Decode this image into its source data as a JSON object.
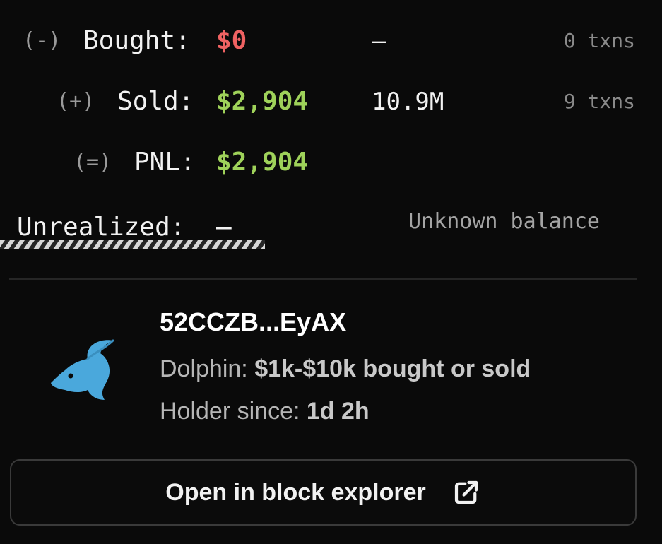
{
  "rows": {
    "bought": {
      "op": "(-)",
      "label": "Bought:",
      "value": "$0",
      "amount": "–",
      "txns": "0 txns"
    },
    "sold": {
      "op": "(+)",
      "label": "Sold:",
      "value": "$2,904",
      "amount": "10.9M",
      "txns": "9 txns"
    },
    "pnl": {
      "op": "(=)",
      "label": "PNL:",
      "value": "$2,904"
    },
    "unrealized": {
      "label": "Unrealized:",
      "value": "–",
      "balance_note": "Unknown balance"
    }
  },
  "holder": {
    "icon": "dolphin-icon",
    "address": "52CCZB...EyAX",
    "tier_label": "Dolphin:",
    "tier_value": "$1k-$10k bought or sold",
    "since_label": "Holder since:",
    "since_value": "1d 2h"
  },
  "actions": {
    "explorer_label": "Open in block explorer",
    "explorer_icon": "external-link-icon"
  },
  "colors": {
    "background": "#0a0a0a",
    "negative": "#f06262",
    "positive": "#9fd25a",
    "dolphin": "#4aa8dc"
  }
}
